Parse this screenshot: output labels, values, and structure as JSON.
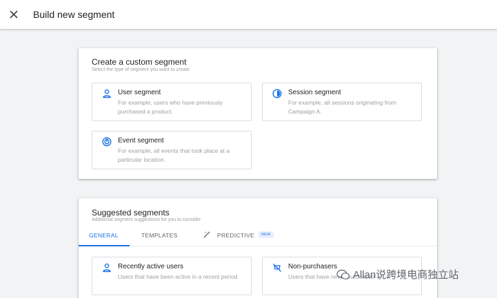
{
  "header": {
    "title": "Build new segment"
  },
  "custom_card": {
    "title": "Create a custom segment",
    "subtitle": "Select the type of segment you want to create",
    "options": [
      {
        "name": "User segment",
        "desc": "For example, users who have previously purchased a product.",
        "icon": "person-icon"
      },
      {
        "name": "Session segment",
        "desc": "For example, all sessions originating from Campaign A.",
        "icon": "session-icon"
      },
      {
        "name": "Event segment",
        "desc": "For example, all events that took place at a particular location.",
        "icon": "event-icon"
      }
    ]
  },
  "suggested_card": {
    "title": "Suggested segments",
    "subtitle": "Additional segment suggestions for you to consider",
    "tabs": [
      {
        "label": "GENERAL",
        "active": true
      },
      {
        "label": "TEMPLATES",
        "active": false
      },
      {
        "label": "PREDICTIVE",
        "active": false,
        "badge": "NEW"
      }
    ],
    "items": [
      {
        "name": "Recently active users",
        "desc": "Users that have been active in a recent period",
        "icon": "person-icon"
      },
      {
        "name": "Non-purchasers",
        "desc": "Users that have never purchased",
        "icon": "no-purchase-icon"
      }
    ]
  },
  "watermark": {
    "text": "Allan说跨境电商独立站"
  },
  "colors": {
    "accent": "#1a73e8",
    "muted": "#9aa0a6",
    "border": "#dadce0"
  }
}
